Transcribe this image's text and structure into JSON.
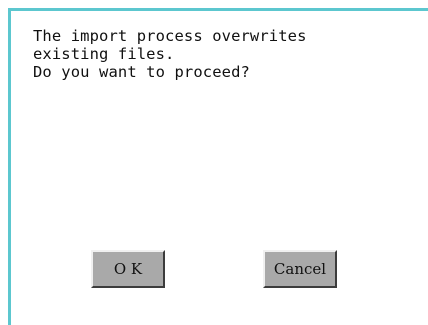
{
  "dialog": {
    "message_lines": [
      "The import process overwrites",
      "existing files.",
      "Do you want to proceed?"
    ],
    "ok_label": "O K",
    "cancel_label": "Cancel"
  },
  "colors": {
    "frame_accent": "#5cc7cf",
    "button_face": "#a9a9a9",
    "background": "#ffffff"
  }
}
